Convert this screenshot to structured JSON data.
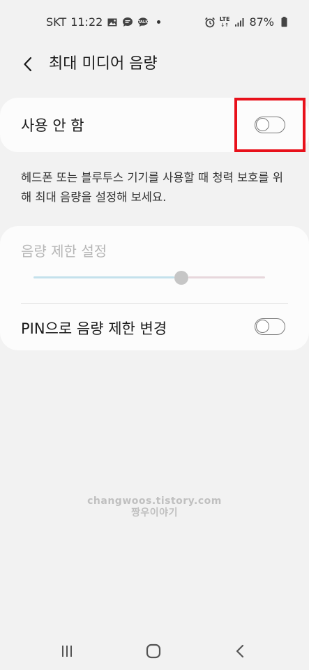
{
  "status_bar": {
    "carrier": "SKT",
    "time": "11:22",
    "network": "LTE",
    "battery": "87%"
  },
  "header": {
    "title": "최대 미디어 음량",
    "back_icon": "back-arrow-icon"
  },
  "master_toggle": {
    "label": "사용 안 함",
    "state": "off"
  },
  "description": "헤드폰 또는 블루투스 기기를 사용할 때 청력 보호를 위해 최대 음량을 설정해 보세요.",
  "volume_limit": {
    "title": "음량 제한 설정",
    "level_fraction": 0.64,
    "enabled": false
  },
  "pin_toggle": {
    "label": "PIN으로 음량 제한 변경",
    "state": "off"
  },
  "watermark": {
    "line1": "changwoos.tistory.com",
    "line2": "짱우이야기"
  },
  "nav": {
    "recents_icon": "recents-icon",
    "home_icon": "home-icon",
    "back_icon": "back-icon"
  },
  "colors": {
    "background": "#f2f2f2",
    "card": "#fcfcfc",
    "highlight": "#e8111b",
    "slider_active": "#c4e1ec"
  }
}
